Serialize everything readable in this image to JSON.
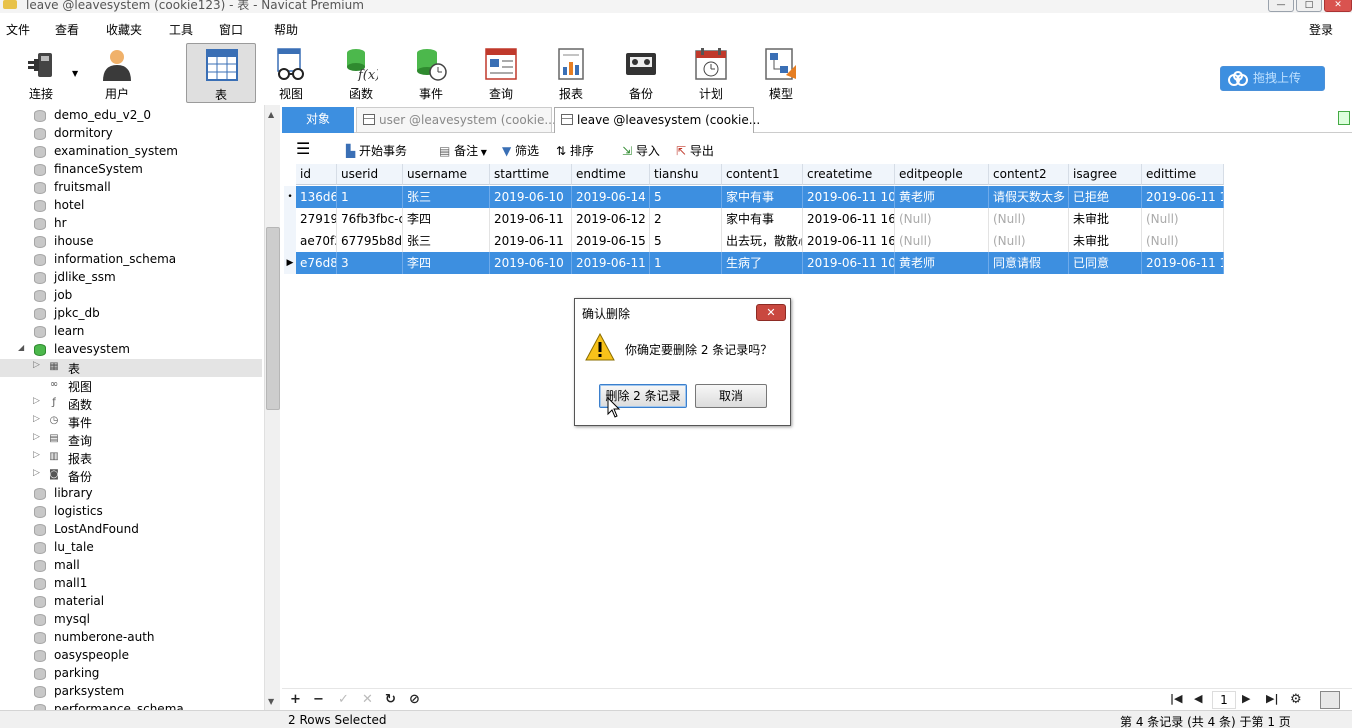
{
  "window": {
    "title": "leave @leavesystem (cookie123) - 表 - Navicat Premium",
    "controls": [
      "—",
      "□",
      "✕"
    ]
  },
  "menubar": {
    "items": [
      "文件",
      "查看",
      "收藏夹",
      "工具",
      "窗口",
      "帮助"
    ],
    "login": "登录"
  },
  "toolbar": {
    "items": [
      {
        "label": "连接",
        "icon": "plug-icon"
      },
      {
        "label": "用户",
        "icon": "user-icon"
      },
      {
        "label": "表",
        "icon": "table-icon"
      },
      {
        "label": "视图",
        "icon": "glasses-icon"
      },
      {
        "label": "函数",
        "icon": "function-icon"
      },
      {
        "label": "事件",
        "icon": "clock-db-icon"
      },
      {
        "label": "查询",
        "icon": "query-icon"
      },
      {
        "label": "报表",
        "icon": "report-icon"
      },
      {
        "label": "备份",
        "icon": "tape-icon"
      },
      {
        "label": "计划",
        "icon": "calendar-icon"
      },
      {
        "label": "模型",
        "icon": "model-icon"
      }
    ],
    "active": "表",
    "upload_label": "拖拽上传"
  },
  "sidebar": {
    "databases_top": [
      "demo_edu_v2_0",
      "dormitory",
      "examination_system",
      "financeSystem",
      "fruitsmall",
      "hotel",
      "hr",
      "ihouse",
      "information_schema",
      "jdlike_ssm",
      "job",
      "jpkc_db",
      "learn"
    ],
    "open_db": "leavesystem",
    "children": [
      {
        "label": "表",
        "icon": "table-icon"
      },
      {
        "label": "视图",
        "icon": "glasses-icon"
      },
      {
        "label": "函数",
        "icon": "function-icon"
      },
      {
        "label": "事件",
        "icon": "event-icon"
      },
      {
        "label": "查询",
        "icon": "query-icon"
      },
      {
        "label": "报表",
        "icon": "report-icon"
      },
      {
        "label": "备份",
        "icon": "backup-icon"
      }
    ],
    "databases_bottom": [
      "library",
      "logistics",
      "LostAndFound",
      "lu_tale",
      "mall",
      "mall1",
      "material",
      "mysql",
      "numberone-auth",
      "oasyspeople",
      "parking",
      "parksystem",
      "performance_schema"
    ]
  },
  "tabs": {
    "objects": "对象",
    "tab1": "user @leavesystem (cookie...",
    "tab2": "leave @leavesystem (cookie..."
  },
  "subtoolbar": {
    "begin_tx": "开始事务",
    "note": "备注",
    "filter": "筛选",
    "sort": "排序",
    "import": "导入",
    "export": "导出"
  },
  "grid": {
    "columns": [
      "id",
      "userid",
      "username",
      "starttime",
      "endtime",
      "tianshu",
      "content1",
      "createtime",
      "editpeople",
      "content2",
      "isagree",
      "edittime"
    ],
    "rows": [
      {
        "selected": true,
        "marker": "•",
        "cells": [
          "136d6t",
          "1",
          "张三",
          "2019-06-10",
          "2019-06-14",
          "5",
          "家中有事",
          "2019-06-11 10:",
          "黄老师",
          "请假天数太多",
          "已拒绝",
          "2019-06-11 1"
        ]
      },
      {
        "selected": false,
        "marker": "",
        "cells": [
          "279197",
          "76fb3fbc-c",
          "李四",
          "2019-06-11",
          "2019-06-12",
          "2",
          "家中有事",
          "2019-06-11 16:",
          "(Null)",
          "(Null)",
          "未审批",
          "(Null)"
        ]
      },
      {
        "selected": false,
        "marker": "",
        "cells": [
          "ae70f3",
          "67795b8d-",
          "张三",
          "2019-06-11",
          "2019-06-15",
          "5",
          "出去玩，散散心",
          "2019-06-11 16:",
          "(Null)",
          "(Null)",
          "未审批",
          "(Null)"
        ]
      },
      {
        "selected": true,
        "marker": "▶",
        "cells": [
          "e76d8c",
          "3",
          "李四",
          "2019-06-10",
          "2019-06-11",
          "1",
          "生病了",
          "2019-06-11 10:",
          "黄老师",
          "同意请假",
          "已同意",
          "2019-06-11 1"
        ]
      }
    ]
  },
  "dialog": {
    "title": "确认删除",
    "close": "✕",
    "message": "你确定要删除 2 条记录吗？",
    "delete_button": "删除 2 条记录",
    "cancel_button": "取消"
  },
  "bottomnav": {
    "add": "+",
    "remove": "−",
    "apply": "✓",
    "discard": "✕",
    "refresh": "↻",
    "stop": "⊘",
    "first": "|◀",
    "prev": "◀",
    "page": "1",
    "next": "▶",
    "last": "▶|",
    "settings": "⚙"
  },
  "status": {
    "selected": "2 Rows Selected",
    "records": "第 4 条记录 (共 4 条) 于第 1 页"
  }
}
